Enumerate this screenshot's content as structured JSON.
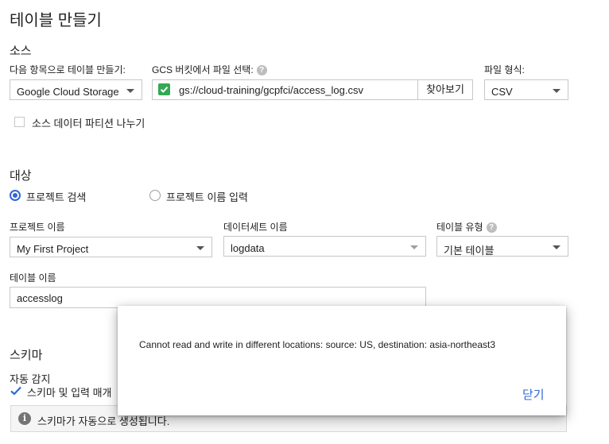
{
  "page_title": "테이블 만들기",
  "source": {
    "heading": "소스",
    "create_from_label": "다음 항목으로 테이블 만들기:",
    "create_from_value": "Google Cloud Storage",
    "gcs_label": "GCS 버킷에서 파일 선택:",
    "gcs_path": "gs://cloud-training/gcpfci/access_log.csv",
    "browse_label": "찾아보기",
    "format_label": "파일 형식:",
    "format_value": "CSV",
    "partition_label": "소스 데이터 파티션 나누기"
  },
  "destination": {
    "heading": "대상",
    "radio_search": "프로젝트 검색",
    "radio_enter": "프로젝트 이름 입력",
    "project_label": "프로젝트 이름",
    "project_value": "My First Project",
    "dataset_label": "데이터세트 이름",
    "dataset_value": "logdata",
    "table_type_label": "테이블 유형",
    "table_type_value": "기본 테이블",
    "table_name_label": "테이블 이름",
    "table_name_value": "accesslog"
  },
  "schema": {
    "heading": "스키마",
    "auto_detect_label": "자동 감지",
    "checkbox_label": "스키마 및 입력 매개",
    "info_text": "스키마가 자동으로 생성됩니다."
  },
  "dialog": {
    "message": "Cannot read and write in different locations: source: US, destination: asia-northeast3",
    "close_label": "닫기"
  },
  "colors": {
    "accent": "#3367d6",
    "check_green": "#34a853"
  }
}
